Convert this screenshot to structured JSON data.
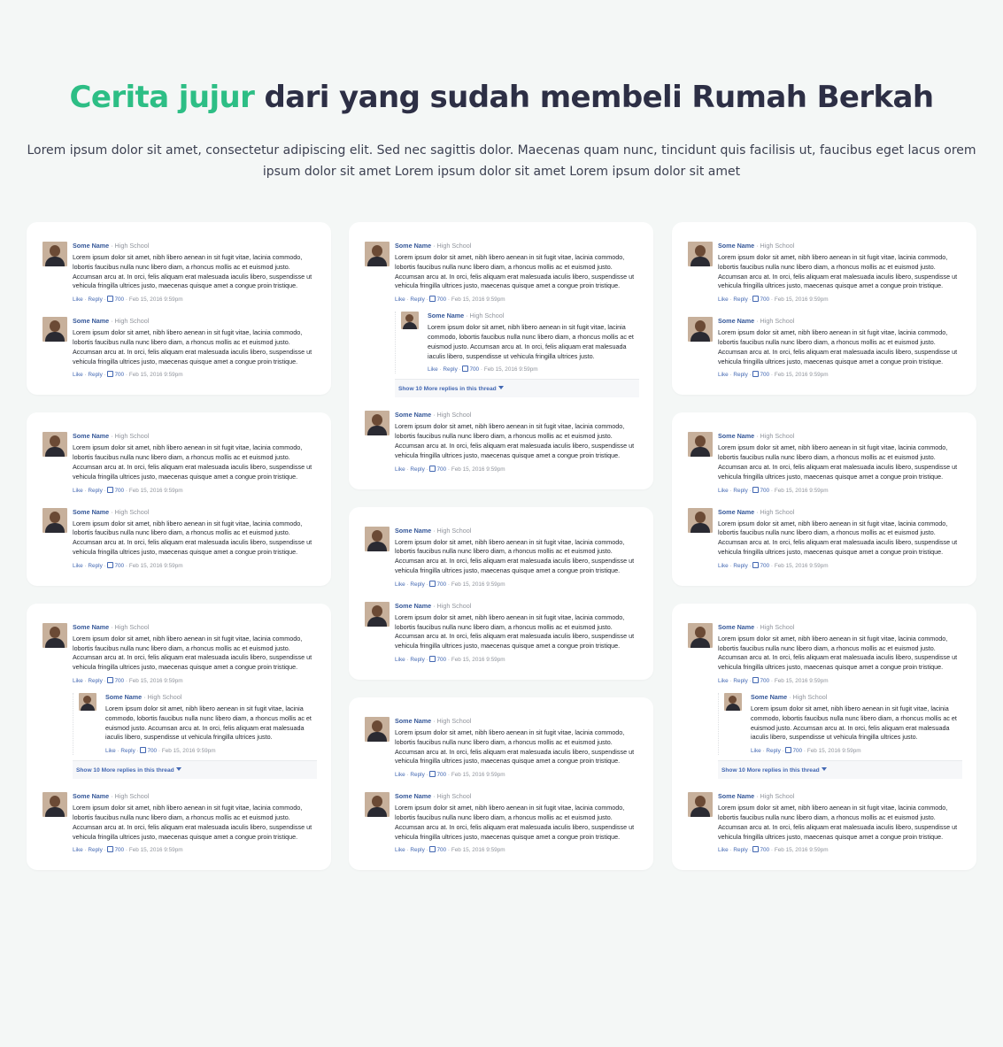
{
  "hero": {
    "title_accent": "Cerita jujur",
    "title_rest": " dari yang sudah membeli Rumah Berkah",
    "subtitle": "Lorem ipsum dolor sit amet, consectetur adipiscing elit. Sed nec sagittis dolor. Maecenas quam nunc, tincidunt quis facilisis ut, faucibus eget lacus orem ipsum dolor sit amet Lorem ipsum dolor sit amet Lorem ipsum dolor sit amet"
  },
  "comment": {
    "name": "Some Name",
    "separator": " · ",
    "school": "High School",
    "text": "Lorem ipsum dolor sit amet, nibh libero aenean in sit fugit vitae, lacinia commodo, lobortis faucibus nulla nunc libero diam, a rhoncus mollis ac et euismod justo. Accumsan arcu at. In orci, felis aliquam erat malesuada iaculis libero, suspendisse ut vehicula fringilla ultrices justo, maecenas quisque amet a congue proin tristique.",
    "like": "Like",
    "dot": " · ",
    "reply": "Reply",
    "likes_count": "700",
    "timestamp": "Feb 15, 2016 9:59pm"
  },
  "reply_comment": {
    "name": "Some Name",
    "school": "High School",
    "text": "Lorem ipsum dolor sit amet, nibh libero aenean in sit fugit vitae, lacinia commodo, lobortis faucibus nulla nunc libero diam, a rhoncus mollis ac et euismod justo. Accumsan arcu at. In orci, felis aliquam erat malesuada iaculis libero, suspendisse ut vehicula fringilla ultrices justo."
  },
  "show_more": "Show 10 More replies in this thread",
  "colors": {
    "accent": "#2dbe85",
    "title": "#2d2f45",
    "fb_link": "#4267b2",
    "fb_name": "#365899",
    "background": "#f4f7f6"
  }
}
